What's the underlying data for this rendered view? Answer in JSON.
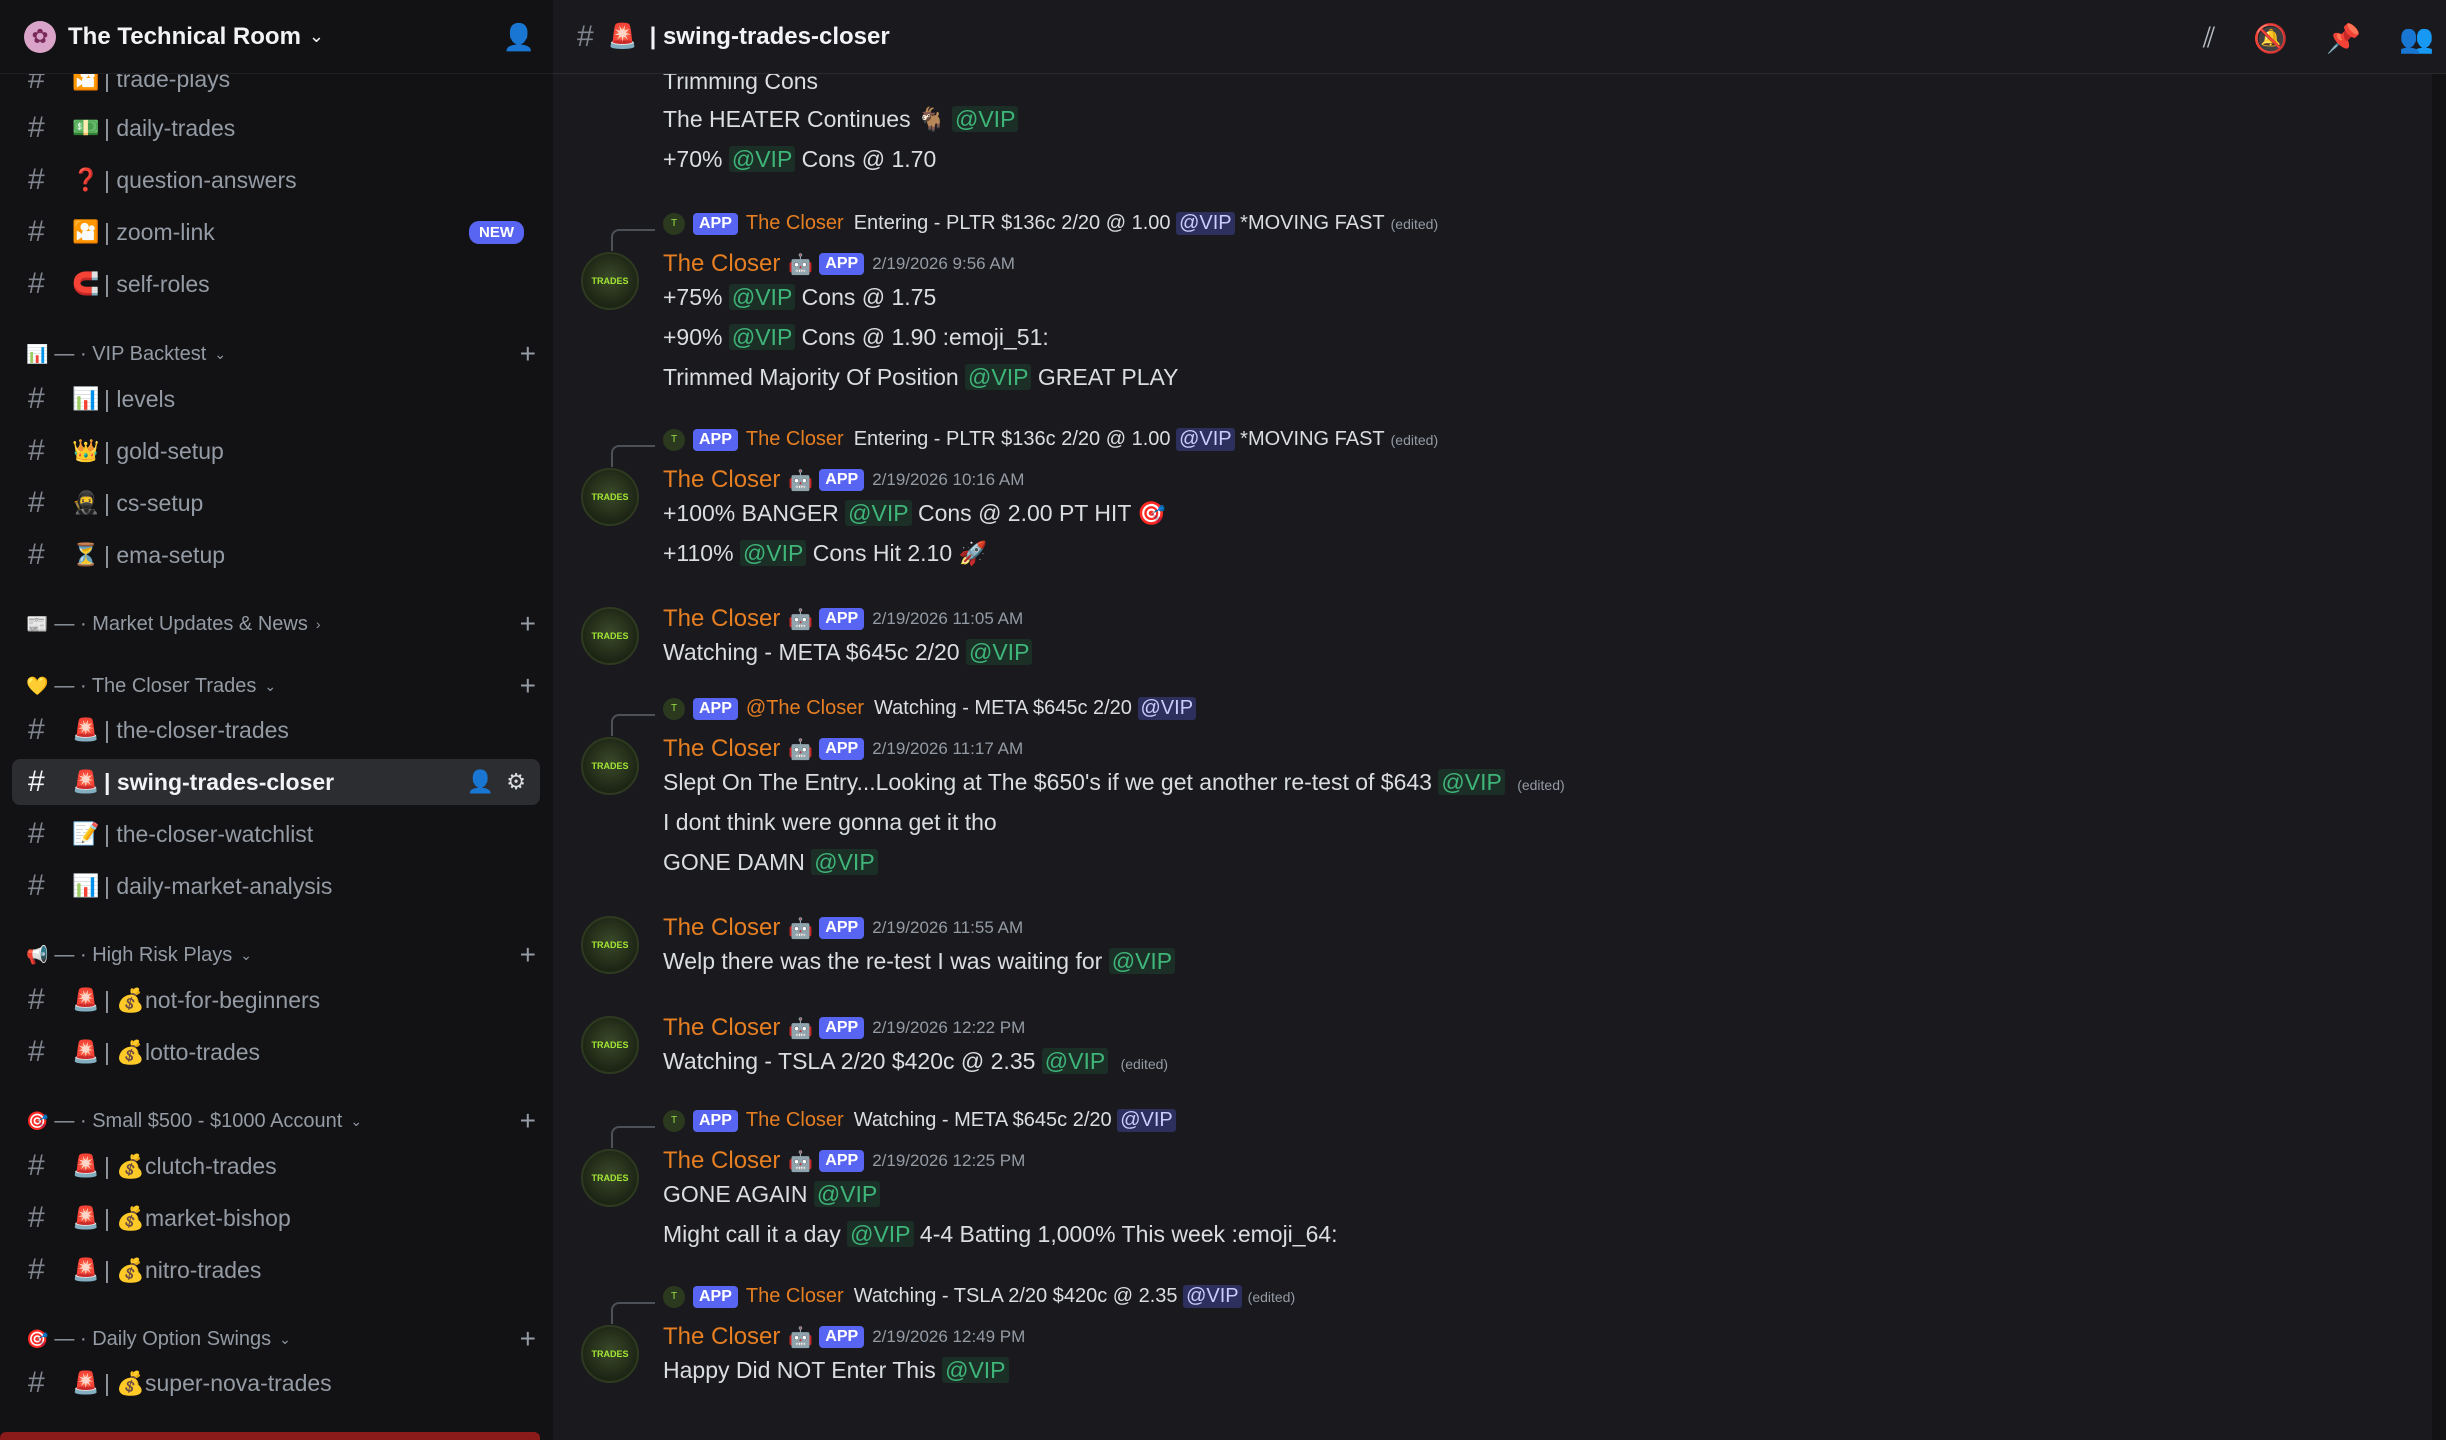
{
  "server": {
    "name": "The Technical Room"
  },
  "channel_header": {
    "title": "| swing-trades-closer"
  },
  "sidebar": {
    "channels": [
      {
        "emoji": "🎦",
        "label": "| trade-plays"
      },
      {
        "emoji": "💵",
        "label": "| daily-trades"
      },
      {
        "emoji": "❓",
        "label": "| question-answers"
      },
      {
        "emoji": "🎦",
        "label": "| zoom-link",
        "badge": "NEW"
      },
      {
        "emoji": "🧲",
        "label": "| self-roles"
      },
      {
        "emoji": "📊",
        "label": "| levels"
      },
      {
        "emoji": "👑",
        "label": "| gold-setup"
      },
      {
        "emoji": "🥷",
        "label": "| cs-setup"
      },
      {
        "emoji": "⏳",
        "label": "| ema-setup"
      },
      {
        "emoji": "🚨",
        "label": "| the-closer-trades"
      },
      {
        "emoji": "🚨",
        "label": "| swing-trades-closer"
      },
      {
        "emoji": "📝",
        "label": "| the-closer-watchlist"
      },
      {
        "emoji": "📊",
        "label": "| daily-market-analysis"
      },
      {
        "emoji": "🚨",
        "label": "| 💰not-for-beginners"
      },
      {
        "emoji": "🚨",
        "label": "| 💰lotto-trades"
      },
      {
        "emoji": "🚨",
        "label": "| 💰clutch-trades"
      },
      {
        "emoji": "🚨",
        "label": "| 💰market-bishop"
      },
      {
        "emoji": "🚨",
        "label": "| 💰nitro-trades"
      },
      {
        "emoji": "🚨",
        "label": "| 💰super-nova-trades"
      }
    ],
    "categories": [
      {
        "emoji": "📊",
        "label": "— · VIP Backtest"
      },
      {
        "emoji": "📰",
        "label": "— · Market Updates & News"
      },
      {
        "emoji": "💛",
        "label": "— · The Closer Trades"
      },
      {
        "emoji": "📢",
        "label": "— · High Risk Plays"
      },
      {
        "emoji": "🎯",
        "label": "— · Small $500 - $1000 Account"
      },
      {
        "emoji": "🎯",
        "label": "— · Daily Option Swings"
      }
    ]
  },
  "messages": {
    "author": "The Closer",
    "app_tag": "APP",
    "mention": "@VIP",
    "mention_closer": "@The Closer",
    "edited": "(edited)",
    "top": {
      "l1": "Trimming Cons",
      "l2": "The HEATER Continues 🐐",
      "l3a": "+70%",
      "l3b": "Cons @ 1.70"
    },
    "m1": {
      "reply_text": "Entering - PLTR $136c 2/20 @ 1.00",
      "reply_tail": "*MOVING FAST",
      "ts": "2/19/2026 9:56 AM",
      "l1a": "+75%",
      "l1b": "Cons @ 1.75",
      "l2a": "+90%",
      "l2b": "Cons @ 1.90 :emoji_51:",
      "l3a": "Trimmed Majority Of Position",
      "l3b": "GREAT PLAY"
    },
    "m2": {
      "reply_text": "Entering - PLTR $136c 2/20 @ 1.00",
      "reply_tail": "*MOVING FAST",
      "ts": "2/19/2026 10:16 AM",
      "l1a": "+100% BANGER",
      "l1b": "Cons @ 2.00 PT HIT 🎯",
      "l2a": "+110%",
      "l2b": "Cons Hit 2.10 🚀"
    },
    "m3": {
      "ts": "2/19/2026 11:05 AM",
      "l1a": "Watching - META $645c 2/20"
    },
    "m4": {
      "reply_text": "Watching - META $645c 2/20",
      "ts": "2/19/2026 11:17 AM",
      "l1a": "Slept On The Entry...Looking at The $650's if we get another re-test of $643",
      "l2": "I dont think were gonna get it tho",
      "l3a": "GONE DAMN"
    },
    "m5": {
      "ts": "2/19/2026 11:55 AM",
      "l1a": "Welp there was the re-test I was waiting for"
    },
    "m6": {
      "ts": "2/19/2026 12:22 PM",
      "l1a": "Watching - TSLA 2/20 $420c @ 2.35"
    },
    "m7": {
      "reply_text": "Watching - META $645c 2/20",
      "ts": "2/19/2026 12:25 PM",
      "l1a": "GONE AGAIN",
      "l2a": "Might call it a day",
      "l2b": "4-4 Batting 1,000% This week :emoji_64:"
    },
    "m8": {
      "reply_text": "Watching - TSLA 2/20 $420c @ 2.35",
      "ts": "2/19/2026 12:49 PM",
      "l1a": "Happy Did NOT Enter This"
    }
  },
  "avatar_text": "TRADES",
  "colors": {
    "accent": "#5865f2",
    "author": "#e67e22",
    "mention": "#3fb57a",
    "active_channel_bg": "#2b2d31"
  }
}
